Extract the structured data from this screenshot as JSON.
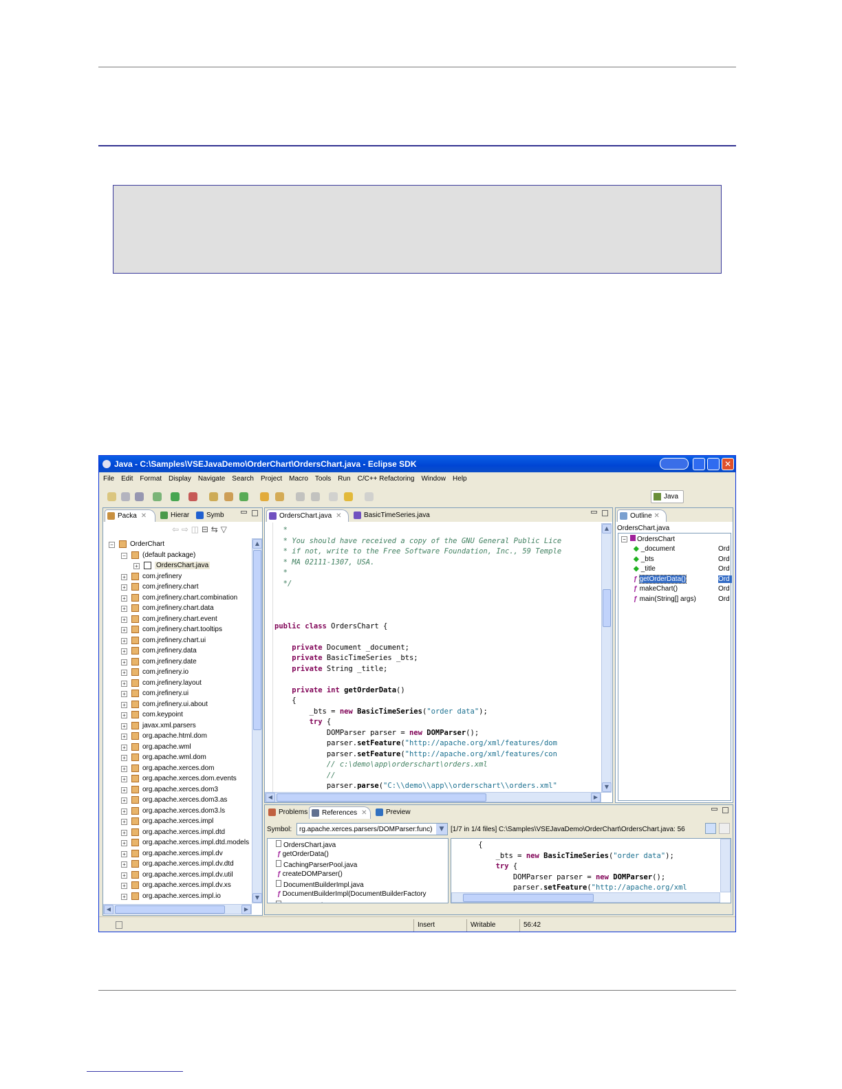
{
  "window": {
    "title": "Java - C:\\Samples\\VSEJavaDemo\\OrderChart\\OrdersChart.java - Eclipse SDK",
    "perspective": "Java"
  },
  "menu": [
    "File",
    "Edit",
    "Format",
    "Display",
    "Navigate",
    "Search",
    "Project",
    "Macro",
    "Tools",
    "Run",
    "C/C++ Refactoring",
    "Window",
    "Help"
  ],
  "left_tabs": [
    "Packa",
    "Hierar",
    "Symb"
  ],
  "tree": {
    "project": "OrderChart",
    "default_package": "(default package)",
    "file": "OrdersChart.java",
    "packages": [
      "com.jrefinery",
      "com.jrefinery.chart",
      "com.jrefinery.chart.combination",
      "com.jrefinery.chart.data",
      "com.jrefinery.chart.event",
      "com.jrefinery.chart.tooltips",
      "com.jrefinery.chart.ui",
      "com.jrefinery.data",
      "com.jrefinery.date",
      "com.jrefinery.io",
      "com.jrefinery.layout",
      "com.jrefinery.ui",
      "com.jrefinery.ui.about",
      "com.keypoint",
      "javax.xml.parsers",
      "org.apache.html.dom",
      "org.apache.wml",
      "org.apache.wml.dom",
      "org.apache.xerces.dom",
      "org.apache.xerces.dom.events",
      "org.apache.xerces.dom3",
      "org.apache.xerces.dom3.as",
      "org.apache.xerces.dom3.ls",
      "org.apache.xerces.impl",
      "org.apache.xerces.impl.dtd",
      "org.apache.xerces.impl.dtd.models",
      "org.apache.xerces.impl.dv",
      "org.apache.xerces.impl.dv.dtd",
      "org.apache.xerces.impl.dv.util",
      "org.apache.xerces.impl.dv.xs",
      "org.apache.xerces.impl.io"
    ]
  },
  "editor_tabs": [
    "OrdersChart.java",
    "BasicTimeSeries.java"
  ],
  "code": [
    [
      [
        "  *",
        "cm"
      ]
    ],
    [
      [
        "  * You should have received a copy of the GNU General Public Lice",
        "cm"
      ]
    ],
    [
      [
        "  * if not, write to the Free Software Foundation, Inc., 59 Temple",
        "cm"
      ]
    ],
    [
      [
        "  * MA 02111-1307, USA.",
        "cm"
      ]
    ],
    [
      [
        "  *",
        "cm"
      ]
    ],
    [
      [
        "  */",
        "cm"
      ]
    ],
    [],
    [],
    [],
    [
      [
        "public class",
        "kw"
      ],
      [
        " OrdersChart {",
        ""
      ]
    ],
    [],
    [
      [
        "    private",
        "kw"
      ],
      [
        " Document _document;",
        ""
      ]
    ],
    [
      [
        "    private",
        "kw"
      ],
      [
        " BasicTimeSeries _bts;",
        ""
      ]
    ],
    [
      [
        "    private",
        "kw"
      ],
      [
        " String _title;",
        ""
      ]
    ],
    [],
    [
      [
        "    private int",
        "kw"
      ],
      [
        " ",
        ""
      ],
      [
        "getOrderData",
        "b"
      ],
      [
        "()",
        ""
      ]
    ],
    [
      [
        "    {",
        ""
      ]
    ],
    [
      [
        "        _bts = ",
        ""
      ],
      [
        "new",
        "kw"
      ],
      [
        " ",
        ""
      ],
      [
        "BasicTimeSeries",
        "b"
      ],
      [
        "(",
        ""
      ],
      [
        "\"order data\"",
        "str"
      ],
      [
        ");",
        ""
      ]
    ],
    [
      [
        "        try",
        "kw"
      ],
      [
        " {",
        ""
      ]
    ],
    [
      [
        "            DOMParser parser = ",
        ""
      ],
      [
        "new",
        "kw"
      ],
      [
        " ",
        ""
      ],
      [
        "DOMParser",
        "b"
      ],
      [
        "();",
        ""
      ]
    ],
    [
      [
        "            parser.",
        ""
      ],
      [
        "setFeature",
        "b"
      ],
      [
        "(",
        ""
      ],
      [
        "\"http://apache.org/xml/features/dom",
        "str"
      ]
    ],
    [
      [
        "            parser.",
        ""
      ],
      [
        "setFeature",
        "b"
      ],
      [
        "(",
        ""
      ],
      [
        "\"http://apache.org/xml/features/con",
        "str"
      ]
    ],
    [
      [
        "            // c:\\demo\\app\\orderschart\\orders.xml",
        "cm"
      ]
    ],
    [
      [
        "            //",
        "cm"
      ]
    ],
    [
      [
        "            parser.",
        ""
      ],
      [
        "parse",
        "b"
      ],
      [
        "(",
        ""
      ],
      [
        "\"C:\\\\demo\\\\app\\\\orderschart\\\\orders.xml\"",
        "str"
      ]
    ]
  ],
  "outline": {
    "tab": "Outline",
    "file": "OrdersChart.java",
    "class": "OrdersChart",
    "members": [
      {
        "name": "_document",
        "kind": "field",
        "suffix": "Ord"
      },
      {
        "name": "_bts",
        "kind": "field",
        "suffix": "Ord"
      },
      {
        "name": "_title",
        "kind": "field",
        "suffix": "Ord"
      },
      {
        "name": "getOrderData()",
        "kind": "method",
        "suffix": "Ord",
        "selected": true
      },
      {
        "name": "makeChart()",
        "kind": "method",
        "suffix": "Ord"
      },
      {
        "name": "main(String[] args)",
        "kind": "method",
        "suffix": "Ord"
      }
    ]
  },
  "bottom_tabs": [
    "Problems",
    "References",
    "Preview"
  ],
  "references": {
    "symbol_label": "Symbol:",
    "symbol_value": "rg.apache.xerces.parsers/DOMParser:func)",
    "location": "[1/7 in 1/4 files] C:\\Samples\\VSEJavaDemo\\OrderChart\\OrdersChart.java: 56",
    "items": [
      {
        "text": "OrdersChart.java",
        "level": 0
      },
      {
        "text": "getOrderData()",
        "level": 1
      },
      {
        "text": "CachingParserPool.java",
        "level": 0
      },
      {
        "text": "createDOMParser()",
        "level": 1
      },
      {
        "text": "DocumentBuilderImpl.java",
        "level": 0
      },
      {
        "text": "DocumentBuilderImpl(DocumentBuilderFactory",
        "level": 1
      },
      {
        "text": "DOMParser.java",
        "level": 0
      }
    ],
    "preview": [
      [
        [
          "    {",
          ""
        ]
      ],
      [
        [
          "        _bts = ",
          ""
        ],
        [
          "new",
          "kw"
        ],
        [
          " ",
          ""
        ],
        [
          "BasicTimeSeries",
          "b"
        ],
        [
          "(",
          ""
        ],
        [
          "\"order data\"",
          "str"
        ],
        [
          ");",
          ""
        ]
      ],
      [
        [
          "        try",
          "kw"
        ],
        [
          " {",
          ""
        ]
      ],
      [
        [
          "            DOMParser parser = ",
          ""
        ],
        [
          "new",
          "kw"
        ],
        [
          " ",
          ""
        ],
        [
          "DOMParser",
          "b"
        ],
        [
          "();",
          ""
        ]
      ],
      [
        [
          "            parser.",
          ""
        ],
        [
          "setFeature",
          "b"
        ],
        [
          "(",
          ""
        ],
        [
          "\"http://apache.org/xml",
          "str"
        ]
      ]
    ]
  },
  "status": {
    "mode": "Insert",
    "writable": "Writable",
    "position": "56:42"
  }
}
